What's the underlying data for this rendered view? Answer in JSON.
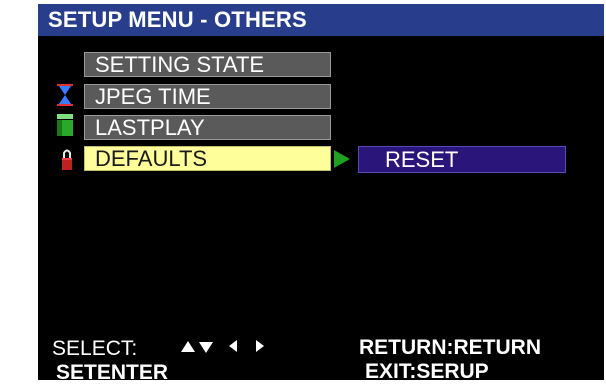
{
  "header": {
    "title": "SETUP MENU - OTHERS"
  },
  "menu": {
    "items": [
      {
        "label": "SETTING STATE",
        "icon": "none"
      },
      {
        "label": "JPEG TIME",
        "icon": "hourglass-icon"
      },
      {
        "label": "LASTPLAY",
        "icon": "box-icon"
      },
      {
        "label": "DEFAULTS",
        "icon": "lock-icon",
        "selected": true
      }
    ],
    "submenu": {
      "label": "RESET"
    }
  },
  "footer": {
    "select_label": "SELECT:",
    "setenter": "SETENTER",
    "return": "RETURN:RETURN",
    "exit": "EXIT:SERUP"
  },
  "colors": {
    "title_bar": "#283e8c",
    "item_bg": "#5a5a5a",
    "selected_bg": "#fefe9a",
    "submenu_bg": "#2a157a",
    "arrow": "#20a020"
  }
}
